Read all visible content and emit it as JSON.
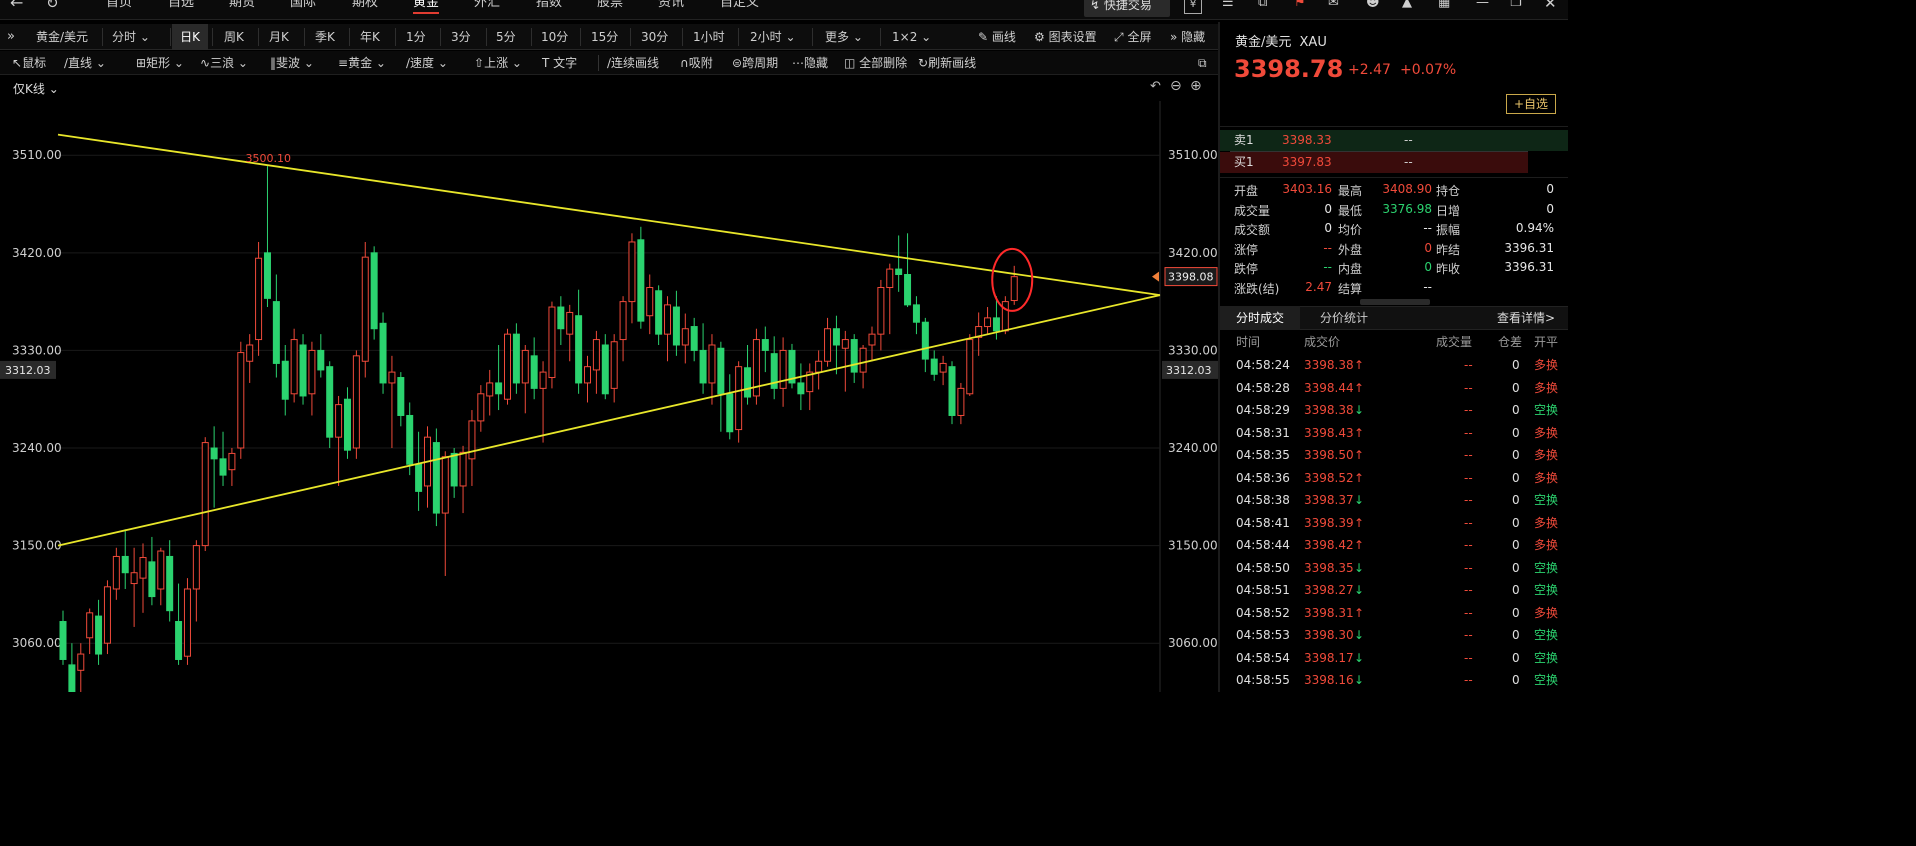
{
  "topnav": {
    "items": [
      "首页",
      "自选",
      "期货",
      "国际",
      "期权",
      "黄金",
      "外汇",
      "指数",
      "股票",
      "资讯",
      "自定义"
    ],
    "active": "黄金",
    "quick_trade": "快捷交易"
  },
  "toolbar1": {
    "symbol": "黄金/美元",
    "periods": [
      "分时",
      "日K",
      "周K",
      "月K",
      "季K",
      "年K",
      "1分",
      "3分",
      "5分",
      "10分",
      "15分",
      "30分",
      "1小时",
      "2小时",
      "更多",
      "1×2"
    ],
    "active_period": "日K",
    "draw": "画线",
    "chart_settings": "图表设置",
    "fullscreen": "全屏",
    "hide": "隐藏"
  },
  "toolbar2": {
    "tools": [
      "鼠标",
      "直线",
      "矩形",
      "三浪",
      "斐波",
      "黄金",
      "速度",
      "上涨",
      "文字"
    ],
    "continuous": "连续画线",
    "snap": "吸附",
    "cross_period": "跨周期",
    "hide": "隐藏",
    "delete_all": "全部删除",
    "refresh": "刷新画线"
  },
  "chart": {
    "indicator_label": "仅K线",
    "peak_label": "3500.10",
    "current_price_tag": "3398.08",
    "cursor_price_tag": "3312.03",
    "colors": {
      "up": "#f04a3a",
      "down": "#2bd36f",
      "trendline": "#e8e62a",
      "highlight": "#ff2a2a"
    }
  },
  "chart_data": {
    "type": "candlestick",
    "title": "",
    "ylim": [
      3015,
      3560
    ],
    "yticks": [
      "3510.00",
      "3420.00",
      "3330.00",
      "3240.00",
      "3150.00",
      "3060.00"
    ],
    "ytick_values": [
      3510,
      3420,
      3330,
      3240,
      3150,
      3060
    ],
    "annotations": [
      "3500.10"
    ],
    "trendlines": [
      {
        "name": "upper",
        "from": [
          0,
          3529
        ],
        "to": [
          110,
          3381
        ]
      },
      {
        "name": "lower",
        "from": [
          0,
          3150
        ],
        "to": [
          110,
          3381
        ]
      }
    ],
    "candles": [
      {
        "o": 3080,
        "h": 3090,
        "l": 3040,
        "c": 3045
      },
      {
        "o": 3040,
        "h": 3060,
        "l": 3000,
        "c": 3010
      },
      {
        "o": 3035,
        "h": 3060,
        "l": 3010,
        "c": 3050
      },
      {
        "o": 3065,
        "h": 3092,
        "l": 3050,
        "c": 3088
      },
      {
        "o": 3085,
        "h": 3100,
        "l": 3040,
        "c": 3050
      },
      {
        "o": 3060,
        "h": 3118,
        "l": 3050,
        "c": 3112
      },
      {
        "o": 3110,
        "h": 3148,
        "l": 3100,
        "c": 3140
      },
      {
        "o": 3140,
        "h": 3165,
        "l": 3110,
        "c": 3125
      },
      {
        "o": 3115,
        "h": 3148,
        "l": 3075,
        "c": 3125
      },
      {
        "o": 3120,
        "h": 3152,
        "l": 3088,
        "c": 3139
      },
      {
        "o": 3135,
        "h": 3158,
        "l": 3095,
        "c": 3103
      },
      {
        "o": 3110,
        "h": 3148,
        "l": 3095,
        "c": 3145
      },
      {
        "o": 3140,
        "h": 3155,
        "l": 3080,
        "c": 3090
      },
      {
        "o": 3080,
        "h": 3115,
        "l": 3040,
        "c": 3045
      },
      {
        "o": 3048,
        "h": 3120,
        "l": 3040,
        "c": 3110
      },
      {
        "o": 3110,
        "h": 3155,
        "l": 3080,
        "c": 3150
      },
      {
        "o": 3150,
        "h": 3250,
        "l": 3145,
        "c": 3245
      },
      {
        "o": 3240,
        "h": 3260,
        "l": 3185,
        "c": 3230
      },
      {
        "o": 3230,
        "h": 3255,
        "l": 3205,
        "c": 3215
      },
      {
        "o": 3220,
        "h": 3240,
        "l": 3205,
        "c": 3235
      },
      {
        "o": 3240,
        "h": 3338,
        "l": 3230,
        "c": 3328
      },
      {
        "o": 3320,
        "h": 3345,
        "l": 3300,
        "c": 3335
      },
      {
        "o": 3340,
        "h": 3430,
        "l": 3325,
        "c": 3415
      },
      {
        "o": 3420,
        "h": 3500,
        "l": 3370,
        "c": 3378
      },
      {
        "o": 3375,
        "h": 3400,
        "l": 3305,
        "c": 3318
      },
      {
        "o": 3320,
        "h": 3335,
        "l": 3270,
        "c": 3285
      },
      {
        "o": 3290,
        "h": 3350,
        "l": 3282,
        "c": 3340
      },
      {
        "o": 3335,
        "h": 3345,
        "l": 3280,
        "c": 3288
      },
      {
        "o": 3290,
        "h": 3338,
        "l": 3270,
        "c": 3330
      },
      {
        "o": 3330,
        "h": 3345,
        "l": 3305,
        "c": 3312
      },
      {
        "o": 3315,
        "h": 3320,
        "l": 3240,
        "c": 3250
      },
      {
        "o": 3250,
        "h": 3288,
        "l": 3205,
        "c": 3280
      },
      {
        "o": 3285,
        "h": 3296,
        "l": 3230,
        "c": 3238
      },
      {
        "o": 3240,
        "h": 3330,
        "l": 3230,
        "c": 3325
      },
      {
        "o": 3320,
        "h": 3430,
        "l": 3305,
        "c": 3416
      },
      {
        "o": 3420,
        "h": 3426,
        "l": 3340,
        "c": 3350
      },
      {
        "o": 3355,
        "h": 3365,
        "l": 3290,
        "c": 3300
      },
      {
        "o": 3300,
        "h": 3325,
        "l": 3240,
        "c": 3310
      },
      {
        "o": 3305,
        "h": 3310,
        "l": 3260,
        "c": 3270
      },
      {
        "o": 3270,
        "h": 3282,
        "l": 3215,
        "c": 3225
      },
      {
        "o": 3225,
        "h": 3255,
        "l": 3182,
        "c": 3200
      },
      {
        "o": 3205,
        "h": 3260,
        "l": 3185,
        "c": 3250
      },
      {
        "o": 3245,
        "h": 3258,
        "l": 3168,
        "c": 3180
      },
      {
        "o": 3180,
        "h": 3237,
        "l": 3122,
        "c": 3232
      },
      {
        "o": 3235,
        "h": 3240,
        "l": 3194,
        "c": 3205
      },
      {
        "o": 3205,
        "h": 3242,
        "l": 3180,
        "c": 3236
      },
      {
        "o": 3230,
        "h": 3275,
        "l": 3205,
        "c": 3265
      },
      {
        "o": 3265,
        "h": 3298,
        "l": 3255,
        "c": 3290
      },
      {
        "o": 3288,
        "h": 3312,
        "l": 3270,
        "c": 3300
      },
      {
        "o": 3300,
        "h": 3335,
        "l": 3275,
        "c": 3290
      },
      {
        "o": 3285,
        "h": 3350,
        "l": 3280,
        "c": 3345
      },
      {
        "o": 3345,
        "h": 3355,
        "l": 3290,
        "c": 3300
      },
      {
        "o": 3300,
        "h": 3335,
        "l": 3272,
        "c": 3330
      },
      {
        "o": 3325,
        "h": 3342,
        "l": 3285,
        "c": 3295
      },
      {
        "o": 3295,
        "h": 3320,
        "l": 3245,
        "c": 3310
      },
      {
        "o": 3305,
        "h": 3375,
        "l": 3295,
        "c": 3370
      },
      {
        "o": 3370,
        "h": 3380,
        "l": 3335,
        "c": 3350
      },
      {
        "o": 3345,
        "h": 3372,
        "l": 3320,
        "c": 3365
      },
      {
        "o": 3362,
        "h": 3386,
        "l": 3290,
        "c": 3300
      },
      {
        "o": 3300,
        "h": 3325,
        "l": 3282,
        "c": 3315
      },
      {
        "o": 3312,
        "h": 3348,
        "l": 3290,
        "c": 3340
      },
      {
        "o": 3335,
        "h": 3345,
        "l": 3285,
        "c": 3290
      },
      {
        "o": 3295,
        "h": 3345,
        "l": 3282,
        "c": 3338
      },
      {
        "o": 3340,
        "h": 3380,
        "l": 3320,
        "c": 3375
      },
      {
        "o": 3375,
        "h": 3438,
        "l": 3355,
        "c": 3430
      },
      {
        "o": 3432,
        "h": 3444,
        "l": 3350,
        "c": 3357
      },
      {
        "o": 3362,
        "h": 3400,
        "l": 3345,
        "c": 3388
      },
      {
        "o": 3385,
        "h": 3390,
        "l": 3335,
        "c": 3345
      },
      {
        "o": 3345,
        "h": 3380,
        "l": 3320,
        "c": 3372
      },
      {
        "o": 3370,
        "h": 3385,
        "l": 3325,
        "c": 3335
      },
      {
        "o": 3335,
        "h": 3364,
        "l": 3318,
        "c": 3350
      },
      {
        "o": 3352,
        "h": 3360,
        "l": 3320,
        "c": 3330
      },
      {
        "o": 3330,
        "h": 3355,
        "l": 3290,
        "c": 3300
      },
      {
        "o": 3300,
        "h": 3345,
        "l": 3280,
        "c": 3335
      },
      {
        "o": 3332,
        "h": 3338,
        "l": 3255,
        "c": 3290
      },
      {
        "o": 3290,
        "h": 3308,
        "l": 3248,
        "c": 3255
      },
      {
        "o": 3257,
        "h": 3320,
        "l": 3245,
        "c": 3315
      },
      {
        "o": 3314,
        "h": 3335,
        "l": 3280,
        "c": 3287
      },
      {
        "o": 3288,
        "h": 3350,
        "l": 3280,
        "c": 3340
      },
      {
        "o": 3340,
        "h": 3352,
        "l": 3310,
        "c": 3330
      },
      {
        "o": 3327,
        "h": 3343,
        "l": 3285,
        "c": 3295
      },
      {
        "o": 3295,
        "h": 3342,
        "l": 3278,
        "c": 3330
      },
      {
        "o": 3330,
        "h": 3336,
        "l": 3295,
        "c": 3300
      },
      {
        "o": 3300,
        "h": 3318,
        "l": 3275,
        "c": 3290
      },
      {
        "o": 3292,
        "h": 3318,
        "l": 3275,
        "c": 3310
      },
      {
        "o": 3310,
        "h": 3330,
        "l": 3294,
        "c": 3320
      },
      {
        "o": 3320,
        "h": 3360,
        "l": 3315,
        "c": 3350
      },
      {
        "o": 3350,
        "h": 3362,
        "l": 3308,
        "c": 3335
      },
      {
        "o": 3332,
        "h": 3348,
        "l": 3292,
        "c": 3340
      },
      {
        "o": 3340,
        "h": 3345,
        "l": 3300,
        "c": 3310
      },
      {
        "o": 3310,
        "h": 3335,
        "l": 3295,
        "c": 3332
      },
      {
        "o": 3335,
        "h": 3352,
        "l": 3320,
        "c": 3345
      },
      {
        "o": 3345,
        "h": 3395,
        "l": 3330,
        "c": 3388
      },
      {
        "o": 3388,
        "h": 3410,
        "l": 3345,
        "c": 3405
      },
      {
        "o": 3405,
        "h": 3436,
        "l": 3384,
        "c": 3400
      },
      {
        "o": 3400,
        "h": 3438,
        "l": 3370,
        "c": 3372
      },
      {
        "o": 3372,
        "h": 3380,
        "l": 3345,
        "c": 3356
      },
      {
        "o": 3356,
        "h": 3360,
        "l": 3310,
        "c": 3322
      },
      {
        "o": 3322,
        "h": 3330,
        "l": 3302,
        "c": 3308
      },
      {
        "o": 3310,
        "h": 3325,
        "l": 3298,
        "c": 3318
      },
      {
        "o": 3315,
        "h": 3320,
        "l": 3262,
        "c": 3270
      },
      {
        "o": 3270,
        "h": 3300,
        "l": 3262,
        "c": 3295
      },
      {
        "o": 3290,
        "h": 3345,
        "l": 3288,
        "c": 3340
      },
      {
        "o": 3342,
        "h": 3365,
        "l": 3325,
        "c": 3352
      },
      {
        "o": 3352,
        "h": 3370,
        "l": 3345,
        "c": 3360
      },
      {
        "o": 3360,
        "h": 3380,
        "l": 3340,
        "c": 3348
      },
      {
        "o": 3348,
        "h": 3380,
        "l": 3345,
        "c": 3375
      },
      {
        "o": 3376,
        "h": 3408,
        "l": 3372,
        "c": 3398
      }
    ]
  },
  "quote": {
    "name": "黄金/美元",
    "code": "XAU",
    "price": "3398.78",
    "change": "+2.47",
    "change_pct": "+0.07%",
    "add_watch": "自选",
    "sell_label": "卖1",
    "sell_price": "3398.33",
    "sell_vol": "--",
    "buy_label": "买1",
    "buy_price": "3397.83",
    "buy_vol": "--",
    "stats": [
      [
        {
          "k": "开盘",
          "v": "3403.16",
          "c": "red"
        },
        {
          "k": "最高",
          "v": "3408.90",
          "c": "red"
        },
        {
          "k": "持仓",
          "v": "0",
          "c": "white"
        }
      ],
      [
        {
          "k": "成交量",
          "v": "0",
          "c": "white"
        },
        {
          "k": "最低",
          "v": "3376.98",
          "c": "green"
        },
        {
          "k": "日增",
          "v": "0",
          "c": "white"
        }
      ],
      [
        {
          "k": "成交额",
          "v": "0",
          "c": "white"
        },
        {
          "k": "均价",
          "v": "--",
          "c": "white"
        },
        {
          "k": "振幅",
          "v": "0.94%",
          "c": "white"
        }
      ],
      [
        {
          "k": "涨停",
          "v": "--",
          "c": "red"
        },
        {
          "k": "外盘",
          "v": "0",
          "c": "red"
        },
        {
          "k": "昨结",
          "v": "3396.31",
          "c": "white"
        }
      ],
      [
        {
          "k": "跌停",
          "v": "--",
          "c": "green"
        },
        {
          "k": "内盘",
          "v": "0",
          "c": "green"
        },
        {
          "k": "昨收",
          "v": "3396.31",
          "c": "white"
        }
      ],
      [
        {
          "k": "涨跌(结)",
          "v": "2.47",
          "c": "red"
        },
        {
          "k": "结算",
          "v": "--",
          "c": "white"
        },
        {
          "k": "",
          "v": "",
          "c": "white"
        }
      ]
    ]
  },
  "trades": {
    "tabs": [
      "分时成交",
      "分价统计"
    ],
    "active_tab": "分时成交",
    "more": "查看详情>",
    "headers": [
      "时间",
      "成交价",
      "成交量",
      "仓差",
      "开平"
    ],
    "rows": [
      {
        "time": "04:58:24",
        "price": "3398.38",
        "dir": "up",
        "vol": "--",
        "diff": "0",
        "type": "多换"
      },
      {
        "time": "04:58:28",
        "price": "3398.44",
        "dir": "up",
        "vol": "--",
        "diff": "0",
        "type": "多换"
      },
      {
        "time": "04:58:29",
        "price": "3398.38",
        "dir": "down",
        "vol": "--",
        "diff": "0",
        "type": "空换"
      },
      {
        "time": "04:58:31",
        "price": "3398.43",
        "dir": "up",
        "vol": "--",
        "diff": "0",
        "type": "多换"
      },
      {
        "time": "04:58:35",
        "price": "3398.50",
        "dir": "up",
        "vol": "--",
        "diff": "0",
        "type": "多换"
      },
      {
        "time": "04:58:36",
        "price": "3398.52",
        "dir": "up",
        "vol": "--",
        "diff": "0",
        "type": "多换"
      },
      {
        "time": "04:58:38",
        "price": "3398.37",
        "dir": "down",
        "vol": "--",
        "diff": "0",
        "type": "空换"
      },
      {
        "time": "04:58:41",
        "price": "3398.39",
        "dir": "up",
        "vol": "--",
        "diff": "0",
        "type": "多换"
      },
      {
        "time": "04:58:44",
        "price": "3398.42",
        "dir": "up",
        "vol": "--",
        "diff": "0",
        "type": "多换"
      },
      {
        "time": "04:58:50",
        "price": "3398.35",
        "dir": "down",
        "vol": "--",
        "diff": "0",
        "type": "空换"
      },
      {
        "time": "04:58:51",
        "price": "3398.27",
        "dir": "down",
        "vol": "--",
        "diff": "0",
        "type": "空换"
      },
      {
        "time": "04:58:52",
        "price": "3398.31",
        "dir": "up",
        "vol": "--",
        "diff": "0",
        "type": "多换"
      },
      {
        "time": "04:58:53",
        "price": "3398.30",
        "dir": "down",
        "vol": "--",
        "diff": "0",
        "type": "空换"
      },
      {
        "time": "04:58:54",
        "price": "3398.17",
        "dir": "down",
        "vol": "--",
        "diff": "0",
        "type": "空换"
      },
      {
        "time": "04:58:55",
        "price": "3398.16",
        "dir": "down",
        "vol": "--",
        "diff": "0",
        "type": "空换"
      }
    ]
  }
}
